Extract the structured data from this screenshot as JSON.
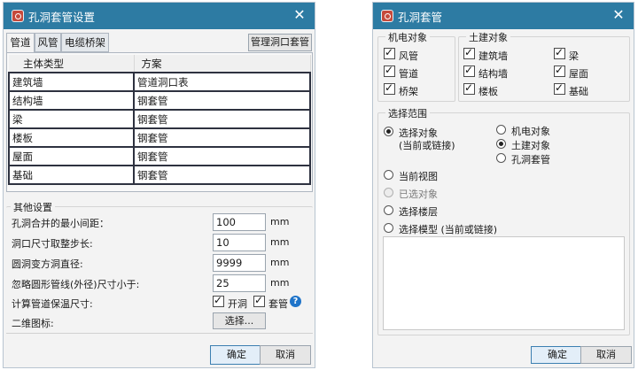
{
  "dialog1": {
    "title": "孔洞套管设置",
    "tabs": [
      "管道",
      "风管",
      "电缆桥架"
    ],
    "manage_button": "管理洞口套管",
    "table": {
      "headers": [
        "主体类型",
        "方案"
      ],
      "rows": [
        [
          "建筑墙",
          "管道洞口表"
        ],
        [
          "结构墙",
          "钢套管"
        ],
        [
          "梁",
          "钢套管"
        ],
        [
          "楼板",
          "钢套管"
        ],
        [
          "屋面",
          "钢套管"
        ],
        [
          "基础",
          "钢套管"
        ]
      ]
    },
    "other_settings": {
      "title": "其他设置",
      "fields": [
        {
          "label": "孔洞合并的最小间距：",
          "value": "100",
          "unit": "mm"
        },
        {
          "label": "洞口尺寸取整步长:",
          "value": "10",
          "unit": "mm"
        },
        {
          "label": "圆洞变方洞直径:",
          "value": "9999",
          "unit": "mm"
        },
        {
          "label": "忽略圆形管线(外径)尺寸小于:",
          "value": "25",
          "unit": "mm"
        }
      ],
      "insulation_label": "计算管道保温尺寸:",
      "insulation_opening": "开洞",
      "insulation_sleeve": "套管",
      "insulation_opening_checked": true,
      "insulation_sleeve_checked": true,
      "icon2d_label": "二维图标:",
      "icon2d_button": "选择..."
    },
    "ok": "确定",
    "cancel": "取消"
  },
  "dialog2": {
    "title": "孔洞套管",
    "mep_group": {
      "title": "机电对象",
      "items": [
        {
          "label": "风管",
          "checked": true
        },
        {
          "label": "管道",
          "checked": true
        },
        {
          "label": "桥架",
          "checked": true
        }
      ]
    },
    "civil_group": {
      "title": "土建对象",
      "items": [
        {
          "label": "建筑墙",
          "checked": true
        },
        {
          "label": "梁",
          "checked": true
        },
        {
          "label": "结构墙",
          "checked": true
        },
        {
          "label": "屋面",
          "checked": true
        },
        {
          "label": "楼板",
          "checked": true
        },
        {
          "label": "基础",
          "checked": true
        }
      ]
    },
    "scope": {
      "title": "选择范围",
      "select_objects": "选择对象",
      "select_objects_sub": "(当前或链接)",
      "sub_options": [
        {
          "label": "机电对象",
          "selected": false
        },
        {
          "label": "土建对象",
          "selected": true
        },
        {
          "label": "孔洞套管",
          "selected": false
        }
      ],
      "current_view": "当前视图",
      "selected_objects": "已选对象",
      "select_levels": "选择楼层",
      "select_models": "选择模型 (当前或链接)"
    },
    "ok": "确定",
    "cancel": "取消"
  }
}
